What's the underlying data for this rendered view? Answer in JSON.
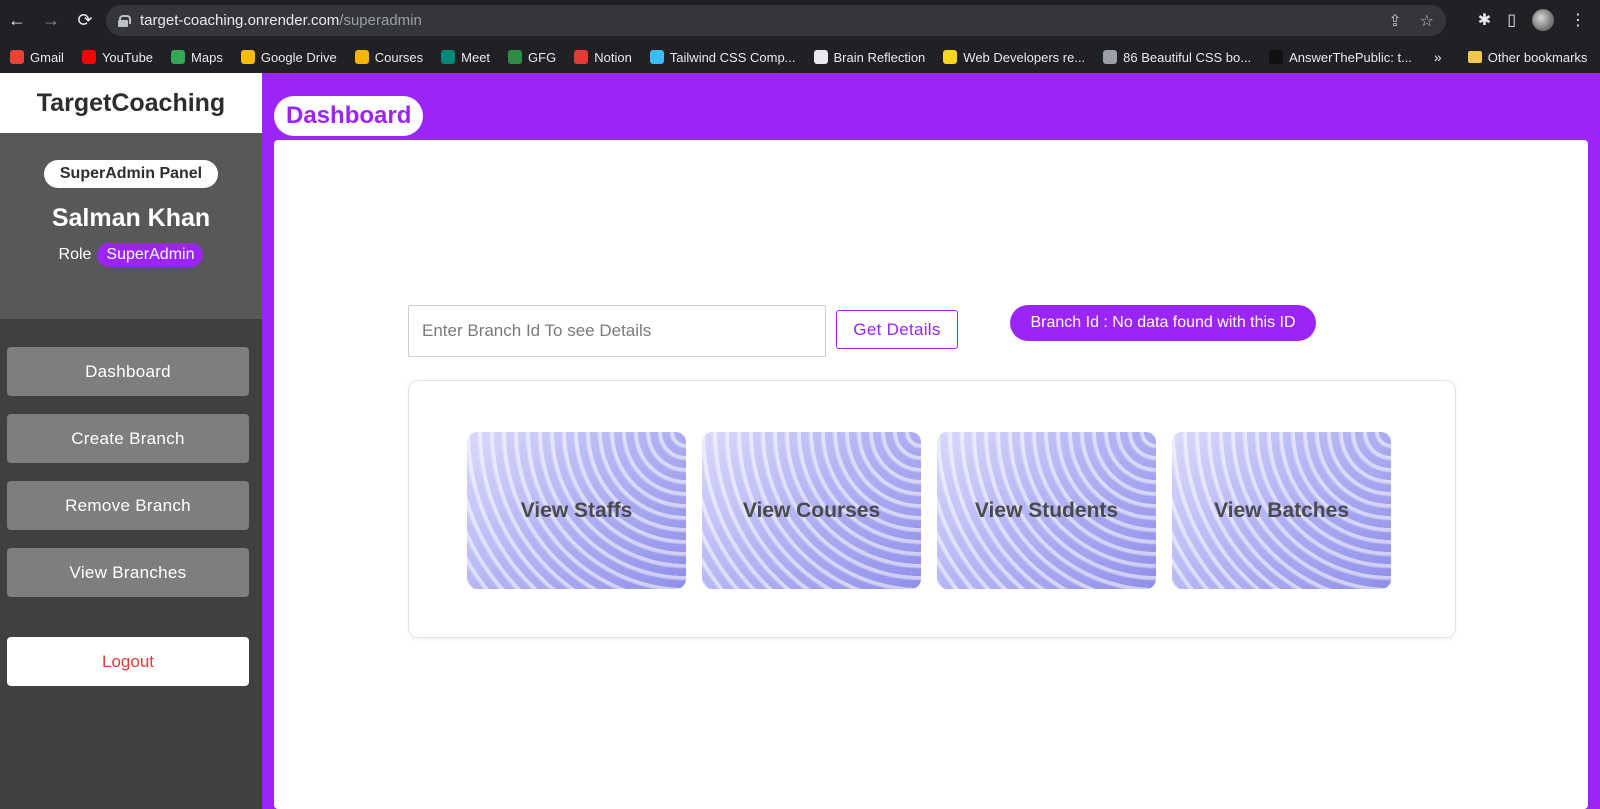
{
  "browser": {
    "url_host": "target-coaching.onrender.com",
    "url_path": "/superadmin",
    "bookmarks": [
      {
        "label": "Gmail",
        "icon": "gmail-icon",
        "color": "#ea4335"
      },
      {
        "label": "YouTube",
        "icon": "youtube-icon",
        "color": "#ff0000"
      },
      {
        "label": "Maps",
        "icon": "maps-icon",
        "color": "#34a853"
      },
      {
        "label": "Google Drive",
        "icon": "drive-icon",
        "color": "#fbbc04"
      },
      {
        "label": "Courses",
        "icon": "classroom-icon",
        "color": "#f4b400"
      },
      {
        "label": "Meet",
        "icon": "meet-icon",
        "color": "#00897b"
      },
      {
        "label": "GFG",
        "icon": "gfg-icon",
        "color": "#2f8d46"
      },
      {
        "label": "Notion",
        "icon": "notion-icon",
        "color": "#e53935"
      },
      {
        "label": "Tailwind CSS Comp...",
        "icon": "tailwind-icon",
        "color": "#38bdf8"
      },
      {
        "label": "Brain Reflection",
        "icon": "globe-icon",
        "color": "#e8eaed"
      },
      {
        "label": "Web Developers re...",
        "icon": "linux-icon",
        "color": "#f9d71c"
      },
      {
        "label": "86 Beautiful CSS bo...",
        "icon": "codepen-icon",
        "color": "#9aa0a6"
      },
      {
        "label": "AnswerThePublic: t...",
        "icon": "atp-icon",
        "color": "#111111"
      }
    ],
    "more": "»",
    "other_bookmarks": "Other bookmarks"
  },
  "sidebar": {
    "brand": "TargetCoaching",
    "panel_label": "SuperAdmin Panel",
    "user_name": "Salman Khan",
    "role_label": "Role",
    "role_value": "SuperAdmin",
    "menu": [
      "Dashboard",
      "Create Branch",
      "Remove Branch",
      "View Branches"
    ],
    "logout": "Logout"
  },
  "main": {
    "title": "Dashboard",
    "search_placeholder": "Enter Branch Id To see Details",
    "get_details": "Get Details",
    "status": "Branch Id : No data found with this ID",
    "cards": [
      "View Staffs",
      "View Courses",
      "View Students",
      "View Batches"
    ]
  },
  "colors": {
    "accent": "#9b24f7",
    "sidebar": "#404040",
    "logout": "#e23b3b"
  }
}
